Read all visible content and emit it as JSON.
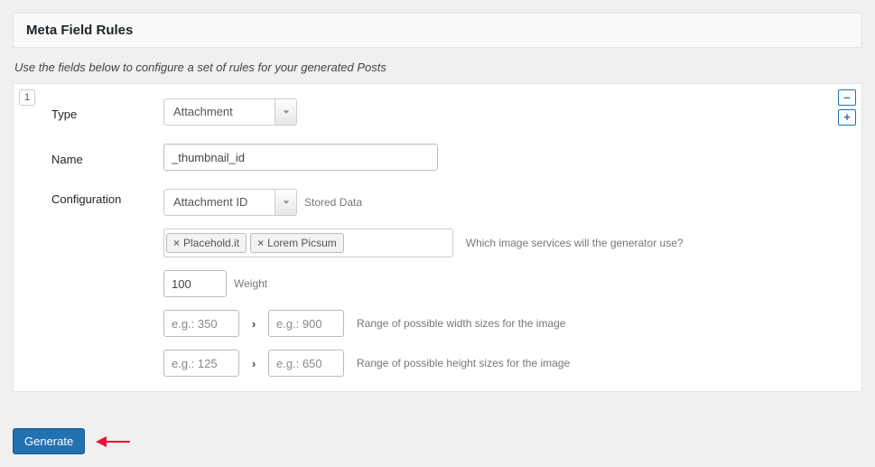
{
  "panel": {
    "title": "Meta Field Rules"
  },
  "help": {
    "intro": "Use the fields below to configure a set of rules for your generated Posts"
  },
  "rule": {
    "index": "1",
    "labels": {
      "type": "Type",
      "name": "Name",
      "config": "Configuration"
    },
    "type_value": "Attachment",
    "name_value": "_thumbnail_id",
    "config_mode": "Attachment ID",
    "config_mode_hint": "Stored Data",
    "tags": [
      "Placehold.it",
      "Lorem Picsum"
    ],
    "tags_hint": "Which image services will the generator use?",
    "weight_value": "100",
    "weight_hint": "Weight",
    "width_min_ph": "e.g.: 350",
    "width_max_ph": "e.g.: 900",
    "width_hint": "Range of possible width sizes for the image",
    "height_min_ph": "e.g.: 125",
    "height_max_ph": "e.g.: 650",
    "height_hint": "Range of possible height sizes for the image"
  },
  "actions": {
    "remove": "–",
    "add": "+"
  },
  "footer": {
    "generate": "Generate"
  },
  "annotation": {
    "arrow_color": "#e6133a"
  }
}
